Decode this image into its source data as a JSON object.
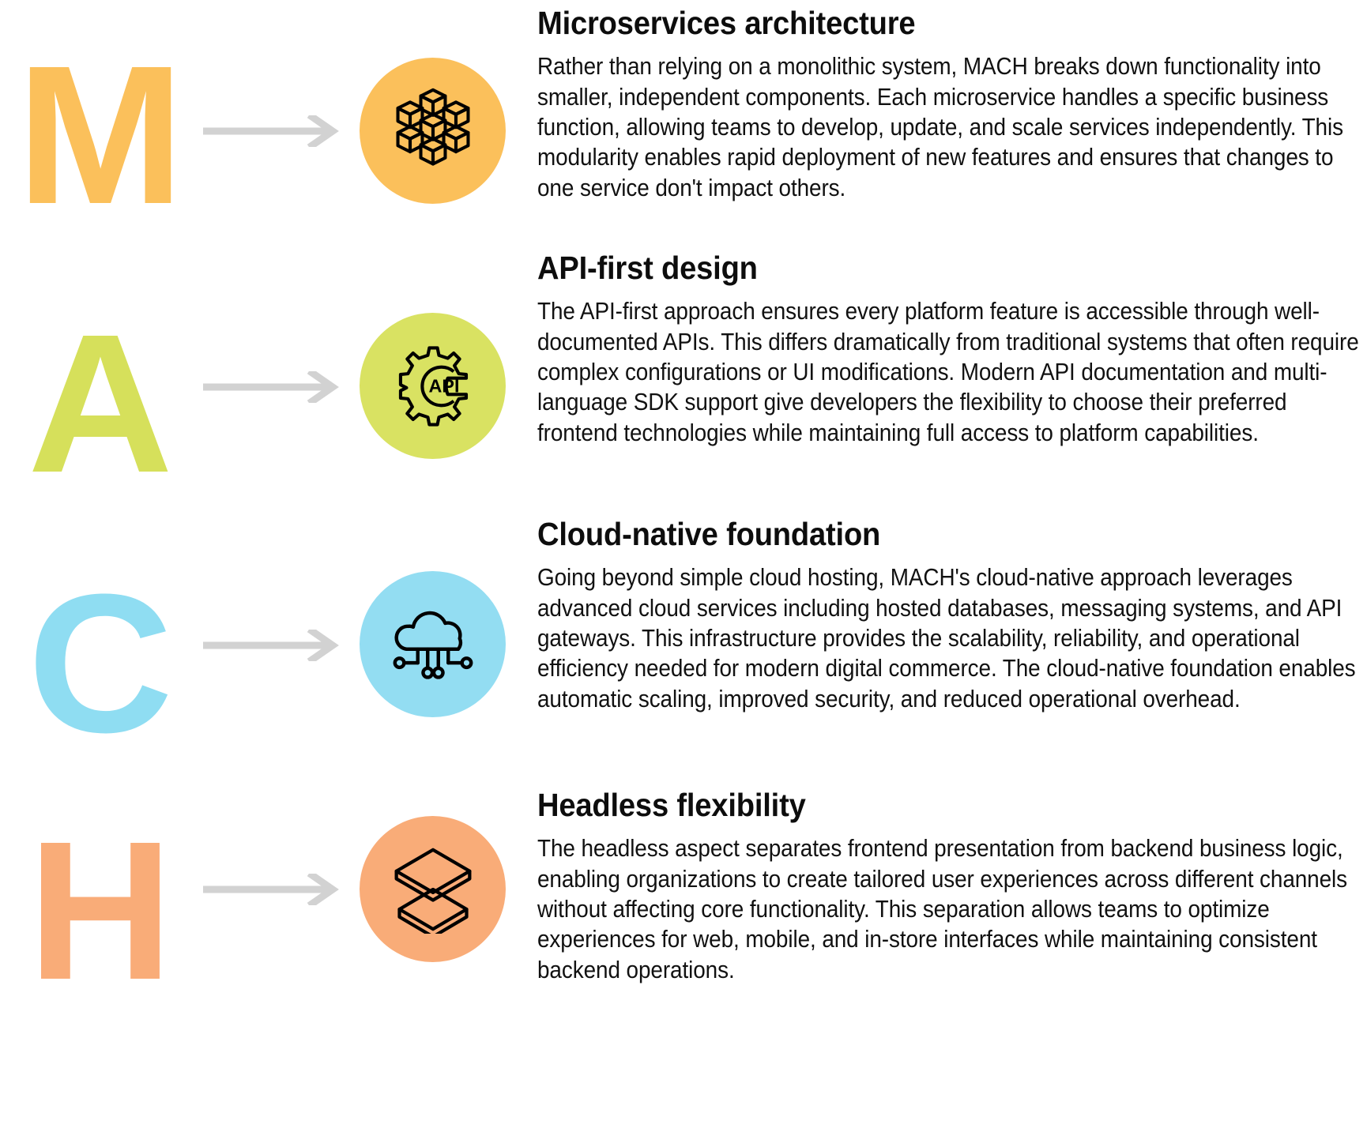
{
  "page": {
    "background": "#ffffff",
    "arrow_color": "#d2d2d2",
    "heading_color": "#0d0d0d",
    "body_color": "#111111"
  },
  "sections": [
    {
      "letter": "M",
      "letter_color": "#fbc05b",
      "bubble_color": "#fbc05b",
      "icon": "cubes-icon",
      "arrow": "arrow-right-icon",
      "heading": "Microservices architecture",
      "body": "Rather than relying on a monolithic system, MACH breaks down functionality into smaller, independent components. Each microservice handles a specific business function, allowing teams to develop, update, and scale services independently. This modularity enables rapid deployment of new features and ensures that changes to one service don't impact others."
    },
    {
      "letter": "A",
      "letter_color": "#d6e05b",
      "bubble_color": "#d9e262",
      "icon": "api-gear-icon",
      "icon_label": "API",
      "arrow": "arrow-right-icon",
      "heading": "API-first design",
      "body": "The API-first approach ensures every platform feature is accessible through well-documented APIs. This differs dramatically from traditional systems that often require complex configurations or UI modifications. Modern API documentation and multi-language SDK support give developers the flexibility to choose their preferred frontend technologies while maintaining full access to platform capabilities."
    },
    {
      "letter": "C",
      "letter_color": "#8fddf2",
      "bubble_color": "#93ddf2",
      "icon": "cloud-network-icon",
      "arrow": "arrow-right-icon",
      "heading": "Cloud-native foundation",
      "body": "Going beyond simple cloud hosting, MACH's cloud-native approach leverages advanced cloud services including hosted databases, messaging systems, and API gateways. This infrastructure provides the scalability, reliability, and operational efficiency needed for modern digital commerce. The cloud-native foundation enables automatic scaling, improved security, and reduced operational overhead."
    },
    {
      "letter": "H",
      "letter_color": "#f9ac78",
      "bubble_color": "#f9ac78",
      "icon": "layers-stack-icon",
      "arrow": "arrow-right-icon",
      "heading": "Headless flexibility",
      "body": "The headless aspect separates frontend presentation from backend business logic, enabling organizations to create tailored user experiences across different channels without affecting core functionality. This separation allows teams to optimize experiences for web, mobile, and in-store interfaces while maintaining consistent backend operations."
    }
  ]
}
